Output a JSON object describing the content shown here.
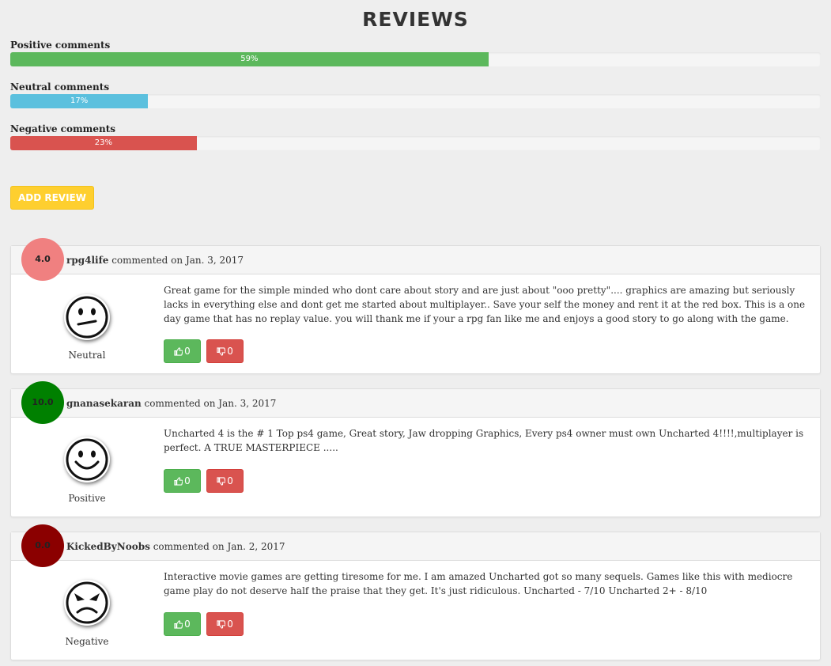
{
  "page": {
    "title": "REVIEWS"
  },
  "stats": [
    {
      "label": "Positive comments",
      "percent_text": "59%",
      "fraction": 0.59,
      "color": "#5cb85c"
    },
    {
      "label": "Neutral comments",
      "percent_text": "17%",
      "fraction": 0.17,
      "color": "#5bc0de"
    },
    {
      "label": "Negative comments",
      "percent_text": "23%",
      "fraction": 0.23,
      "color": "#d9534f"
    }
  ],
  "add_review_label": "ADD REVIEW",
  "reviews": [
    {
      "score": "4.0",
      "score_color": "#f08080",
      "user": "rpg4life",
      "action": "commented on",
      "date": "Jan. 3, 2017",
      "sentiment": "Neutral",
      "face_icon": "neutral-face-icon",
      "text": "Great game for the simple minded who dont care about story and are just about \"ooo pretty\".... graphics are amazing but seriously lacks in everything else and dont get me started about multiplayer.. Save your self the money and rent it at the red box. This is a one day game that has no replay value. you will thank me if your a rpg fan like me and enjoys a good story to go along with the game.",
      "likes": "0",
      "dislikes": "0"
    },
    {
      "score": "10.0",
      "score_color": "#008000",
      "user": "gnanasekaran",
      "action": "commented on",
      "date": "Jan. 3, 2017",
      "sentiment": "Positive",
      "face_icon": "smiley-face-icon",
      "text": "Uncharted 4 is the # 1 Top ps4 game, Great story, Jaw dropping Graphics, Every ps4 owner must own Uncharted 4!!!!,multiplayer is perfect. A TRUE MASTERPIECE .....",
      "likes": "0",
      "dislikes": "0"
    },
    {
      "score": "0.0",
      "score_color": "#8b0000",
      "user": "KickedByNoobs",
      "action": "commented on",
      "date": "Jan. 2, 2017",
      "sentiment": "Negative",
      "face_icon": "angry-face-icon",
      "text": "Interactive movie games are getting tiresome for me. I am amazed Uncharted got so many sequels. Games like this with mediocre game play do not deserve half the praise that they get. It's just ridiculous. Uncharted - 7/10 Uncharted 2+ - 8/10",
      "likes": "0",
      "dislikes": "0"
    }
  ]
}
